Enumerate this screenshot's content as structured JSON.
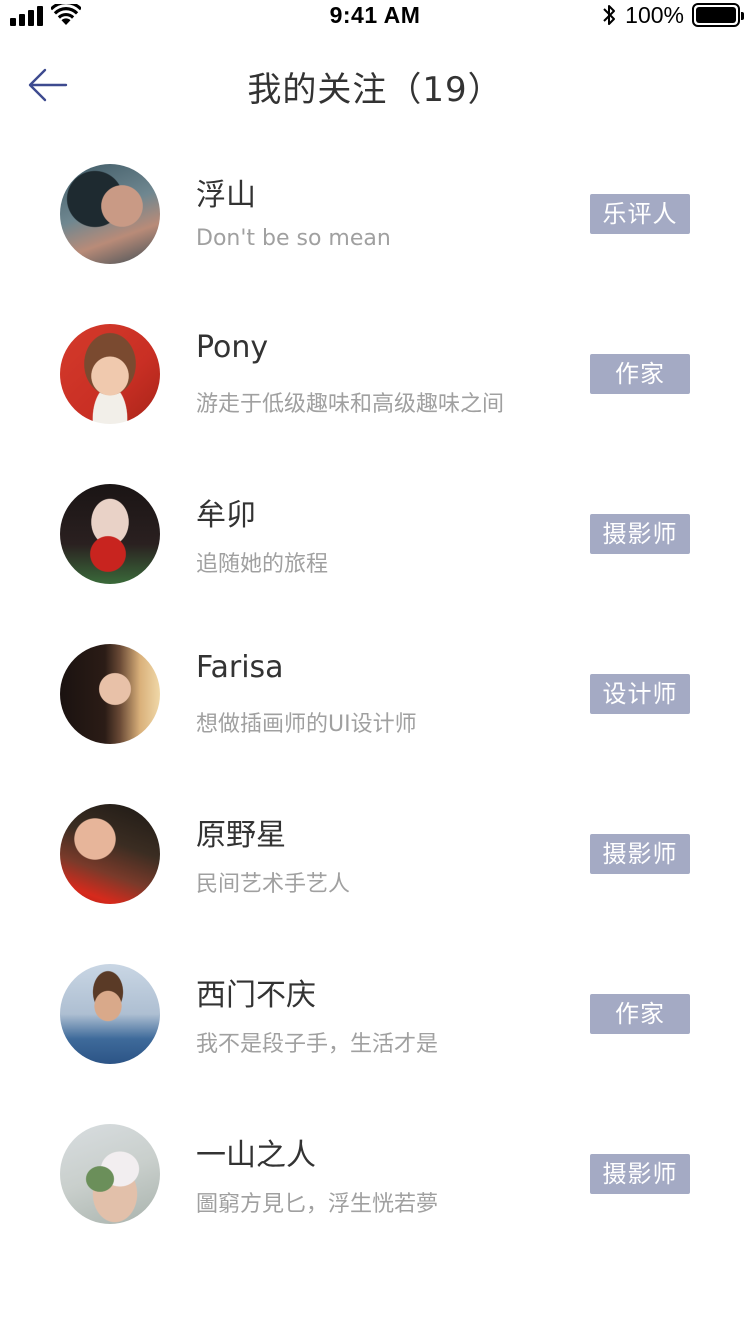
{
  "status_bar": {
    "time": "9:41 AM",
    "battery": "100%"
  },
  "header": {
    "title": "我的关注（19）",
    "back_icon": "arrow-left-icon"
  },
  "colors": {
    "tag_bg": "#a4aac4",
    "back_arrow": "#3d4a8f",
    "name_text": "#333333",
    "bio_text": "#a0a0a0"
  },
  "follows": [
    {
      "name": "浮山",
      "bio": "Don't be so mean",
      "tag": "乐评人"
    },
    {
      "name": "Pony",
      "bio": "游走于低级趣味和高级趣味之间",
      "tag": "作家"
    },
    {
      "name": "牟卯",
      "bio": "追随她的旅程",
      "tag": "摄影师"
    },
    {
      "name": "Farisa",
      "bio": "想做插画师的UI设计师",
      "tag": "设计师"
    },
    {
      "name": "原野星",
      "bio": "民间艺术手艺人",
      "tag": "摄影师"
    },
    {
      "name": "西门不庆",
      "bio": "我不是段子手，生活才是",
      "tag": "作家"
    },
    {
      "name": "一山之人",
      "bio": "圖窮方見匕，浮生恍若夢",
      "tag": "摄影师"
    }
  ]
}
